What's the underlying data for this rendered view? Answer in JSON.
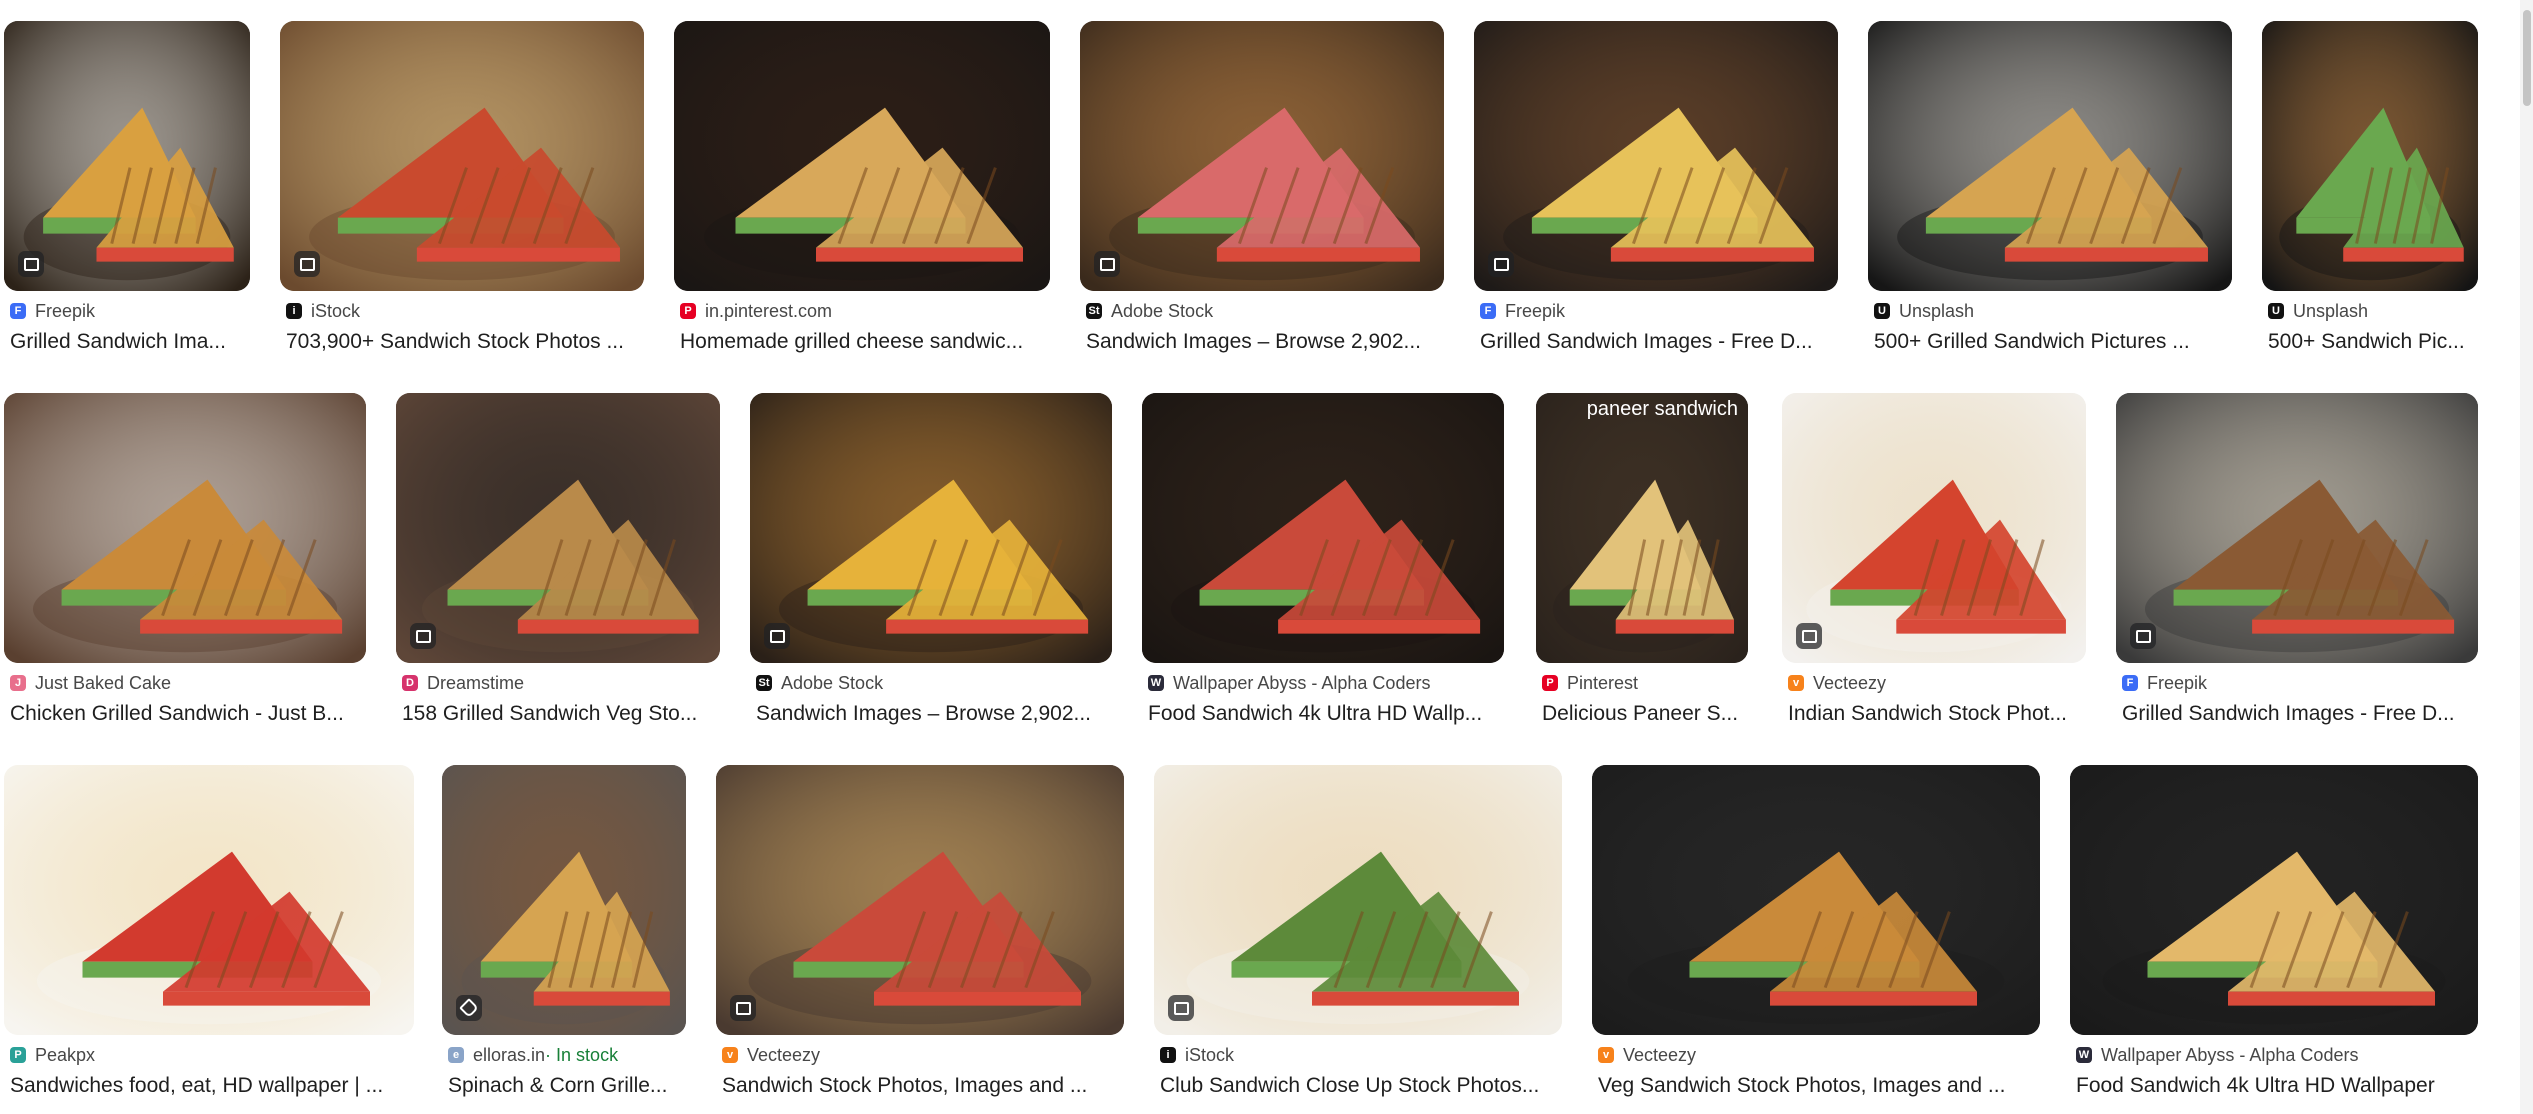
{
  "results": [
    {
      "source": "Freepik",
      "title": "Grilled Sandwich Ima...",
      "icon": "image-icon",
      "favicon": {
        "bg": "#3B6CF6",
        "glyph": "F"
      },
      "palette": [
        "#2c2218",
        "#f2efe9",
        "#d9a040"
      ]
    },
    {
      "source": "iStock",
      "title": "703,900+ Sandwich Stock Photos ...",
      "icon": "image-icon",
      "favicon": {
        "bg": "#111111",
        "glyph": "i"
      },
      "palette": [
        "#6b4a2e",
        "#e8c98a",
        "#c94a2e"
      ]
    },
    {
      "source": "in.pinterest.com",
      "title": "Homemade grilled cheese sandwic...",
      "icon": "",
      "favicon": {
        "bg": "#E60023",
        "glyph": "P"
      },
      "palette": [
        "#1a1614",
        "#3a2418",
        "#d8a85a"
      ]
    },
    {
      "source": "Adobe Stock",
      "title": "Sandwich Images – Browse 2,902...",
      "icon": "image-icon",
      "favicon": {
        "bg": "#111111",
        "glyph": "St"
      },
      "palette": [
        "#3a2a1c",
        "#c98a4a",
        "#d96a6a"
      ]
    },
    {
      "source": "Freepik",
      "title": "Grilled Sandwich Images - Free D...",
      "icon": "image-icon",
      "favicon": {
        "bg": "#3B6CF6",
        "glyph": "F"
      },
      "palette": [
        "#1e1a18",
        "#8a5a34",
        "#e7c25a"
      ]
    },
    {
      "source": "Unsplash",
      "title": "500+ Grilled Sandwich Pictures ...",
      "icon": "",
      "favicon": {
        "bg": "#111111",
        "glyph": "U"
      },
      "palette": [
        "#161616",
        "#e8e4dc",
        "#d6a451"
      ]
    },
    {
      "source": "Unsplash",
      "title": "500+ Sandwich Pic...",
      "icon": "",
      "favicon": {
        "bg": "#111111",
        "glyph": "U"
      },
      "palette": [
        "#141414",
        "#c98a4a",
        "#6aa84f"
      ]
    },
    {
      "source": "Just Baked Cake",
      "title": "Chicken Grilled Sandwich - Just B...",
      "icon": "",
      "favicon": {
        "bg": "#E86F8C",
        "glyph": "J"
      },
      "palette": [
        "#5a4030",
        "#eeeae4",
        "#c98a3a"
      ]
    },
    {
      "source": "Dreamstime",
      "title": "158 Grilled Sandwich Veg Sto...",
      "icon": "image-icon",
      "favicon": {
        "bg": "#D6336C",
        "glyph": "D"
      },
      "palette": [
        "#5e4638",
        "#1d1d1d",
        "#b98a4a"
      ]
    },
    {
      "source": "Adobe Stock",
      "title": "Sandwich Images – Browse 2,902...",
      "icon": "image-icon",
      "favicon": {
        "bg": "#111111",
        "glyph": "St"
      },
      "palette": [
        "#2a2018",
        "#c98a3a",
        "#e6b23a"
      ]
    },
    {
      "source": "Wallpaper Abyss - Alpha Coders",
      "title": "Food Sandwich 4k Ultra HD Wallp...",
      "icon": "",
      "favicon": {
        "bg": "#2B2B3A",
        "glyph": "W"
      },
      "palette": [
        "#1a1512",
        "#3a2a1e",
        "#c94a3a"
      ]
    },
    {
      "source": "Pinterest",
      "title": "Delicious Paneer S...",
      "icon": "",
      "favicon": {
        "bg": "#E60023",
        "glyph": "P"
      },
      "overlay_text": "paneer sandwich",
      "palette": [
        "#2a221c",
        "#4a3a2a",
        "#e2c27a"
      ]
    },
    {
      "source": "Vecteezy",
      "title": "Indian Sandwich Stock Phot...",
      "icon": "image-icon",
      "favicon": {
        "bg": "#F7821B",
        "glyph": "v"
      },
      "palette": [
        "#f3f1ee",
        "#e8d5b0",
        "#d4442e"
      ]
    },
    {
      "source": "Freepik",
      "title": "Grilled Sandwich Images - Free D...",
      "icon": "image-icon",
      "favicon": {
        "bg": "#3B6CF6",
        "glyph": "F"
      },
      "palette": [
        "#3a3a3a",
        "#f0e6d2",
        "#8a5a34"
      ]
    },
    {
      "source": "Peakpx",
      "title": "Sandwiches food, eat, HD wallpaper | ...",
      "icon": "",
      "favicon": {
        "bg": "#2AA198",
        "glyph": "P"
      },
      "palette": [
        "#f7f5f0",
        "#efd9a8",
        "#d23a2e"
      ]
    },
    {
      "source": "elloras.in",
      "source_extra": " · In stock",
      "title": "Spinach & Corn Grille...",
      "icon": "tag-icon",
      "favicon": {
        "bg": "#8AA4C8",
        "glyph": "e"
      },
      "palette": [
        "#5a5450",
        "#8a5a34",
        "#d6a451"
      ]
    },
    {
      "source": "Vecteezy",
      "title": "Sandwich Stock Photos, Images and ...",
      "icon": "image-icon",
      "favicon": {
        "bg": "#F7821B",
        "glyph": "v"
      },
      "palette": [
        "#4a3a30",
        "#e0b46a",
        "#c94a3a"
      ]
    },
    {
      "source": "iStock",
      "title": "Club Sandwich Close Up Stock Photos...",
      "icon": "image-icon",
      "favicon": {
        "bg": "#111111",
        "glyph": "i"
      },
      "palette": [
        "#f2efe8",
        "#e9cfa0",
        "#5d8a3a"
      ]
    },
    {
      "source": "Vecteezy",
      "title": "Veg Sandwich Stock Photos, Images and ...",
      "icon": "",
      "favicon": {
        "bg": "#F7821B",
        "glyph": "v"
      },
      "palette": [
        "#1c1c1c",
        "#2e2e2e",
        "#c98a3a"
      ]
    },
    {
      "source": "Wallpaper Abyss - Alpha Coders",
      "title": "Food Sandwich 4k Ultra HD Wallpaper",
      "icon": "",
      "favicon": {
        "bg": "#2B2B3A",
        "glyph": "W"
      },
      "palette": [
        "#1a1a1a",
        "#2a2a2a",
        "#e3b86a"
      ]
    }
  ]
}
